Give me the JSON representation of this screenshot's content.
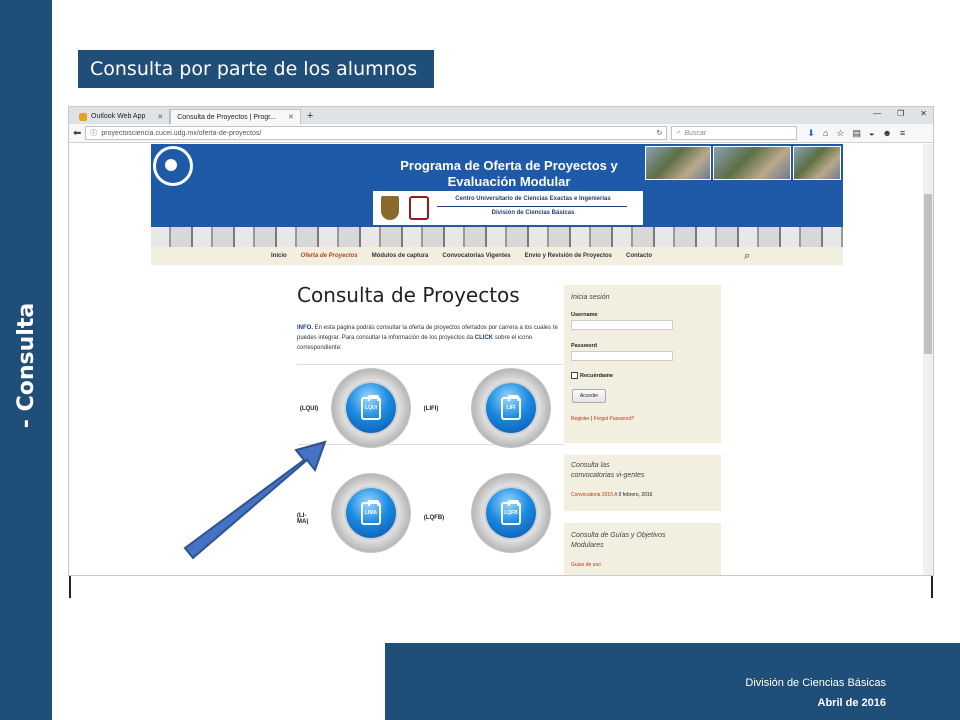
{
  "slide": {
    "vertical_title": "- Consulta",
    "title_box": "Consulta por parte de los alumnos",
    "footer": {
      "department": "División de Ciencias Básicas",
      "date": "Abril de 2016"
    }
  },
  "browser": {
    "tabs": [
      {
        "label": "Outlook Web App",
        "icon": "outlook-icon",
        "active": false
      },
      {
        "label": "Consulta de Proyectos | Progr...",
        "active": true
      }
    ],
    "new_tab_symbol": "+",
    "url": "proyectosciencia.cucei.udg.mx/oferta-de-proyectos/",
    "search_placeholder": "Buscar"
  },
  "site": {
    "header_title": "Programa de Oferta de Proyectos y Evaluación Modular",
    "institution": "Centro Universitario de Ciencias Exactas e Ingenierías",
    "division": "División de Ciencias Básicas",
    "menu": [
      "Inicio",
      "Oferta de Proyectos",
      "Módulos de captura",
      "Convocatorias Vigentes",
      "Envío y Revisión de Proyectos",
      "Contacto"
    ],
    "active_menu": "Oferta de Proyectos",
    "page_heading": "Consulta de Proyectos",
    "info_label": "INFO.",
    "info_text_1": " En esta página podrás consultar la oferta de proyectos ofertados por carrera a los cuales te puedes integrar. Para consultar la información de los proyectos  da ",
    "info_click": "CLICK",
    "info_text_2": " sobre el icono correspondiente:",
    "programs": [
      {
        "code": "(LQUI)",
        "icon": "LQUI"
      },
      {
        "code": "(LIFI)",
        "icon": "LIFI"
      },
      {
        "code": "(LI-MA)",
        "icon": "LIMA"
      },
      {
        "code": "(LQFB)",
        "icon": "LQFB"
      }
    ],
    "login": {
      "title": "Inicia sesión",
      "username_label": "Username",
      "password_label": "Password",
      "remember_label": "Recuérdame",
      "button": "Acceder",
      "register": "Register",
      "separator": " | ",
      "forgot": "Forgot Password?"
    },
    "convocatorias": {
      "title": "Consulta las convocatorias vi-gentes",
      "link": "Convocatoria 2016 A",
      "date": " 9 febrero, 2016"
    },
    "guias": {
      "title": "Consulta de Guías y Objetivos Modulares",
      "link": "Guías de uso"
    }
  }
}
